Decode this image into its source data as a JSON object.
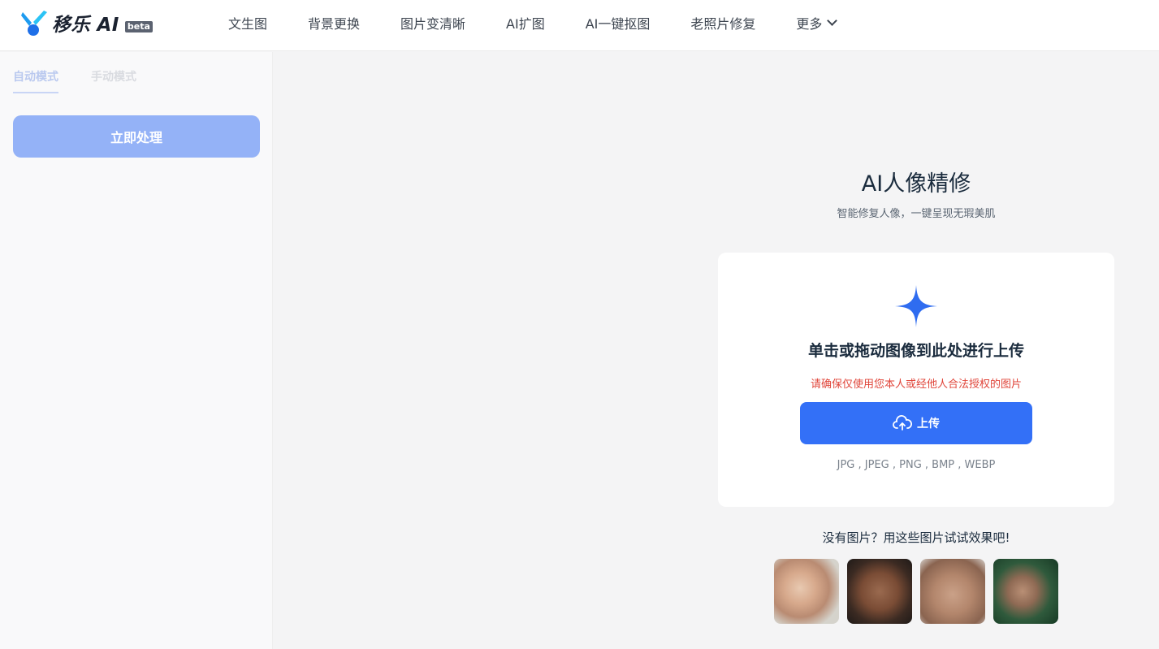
{
  "header": {
    "logo_text": "移乐 AI",
    "badge": "beta",
    "nav": [
      {
        "label": "文生图"
      },
      {
        "label": "背景更换"
      },
      {
        "label": "图片变清晰"
      },
      {
        "label": "AI扩图"
      },
      {
        "label": "AI一键抠图"
      },
      {
        "label": "老照片修复"
      },
      {
        "label": "更多"
      }
    ]
  },
  "sidebar": {
    "tabs": [
      {
        "label": "自动模式",
        "active": true
      },
      {
        "label": "手动模式",
        "active": false
      }
    ],
    "process_button": "立即处理"
  },
  "main": {
    "title": "AI人像精修",
    "subtitle": "智能修复人像，一键呈现无瑕美肌",
    "upload_card": {
      "drop_text": "单击或拖动图像到此处进行上传",
      "warning": "请确保仅使用您本人或经他人合法授权的图片",
      "upload_button": "上传",
      "formats": "JPG , JPEG , PNG , BMP , WEBP"
    },
    "samples_title": "没有图片？用这些图片试试效果吧!",
    "samples": [
      {
        "icon": "sample-face-1"
      },
      {
        "icon": "sample-face-2"
      },
      {
        "icon": "sample-face-3"
      },
      {
        "icon": "sample-face-4"
      }
    ]
  },
  "colors": {
    "accent": "#3370f7",
    "disabled_button": "#94b2f7",
    "warning": "#e0453a"
  }
}
